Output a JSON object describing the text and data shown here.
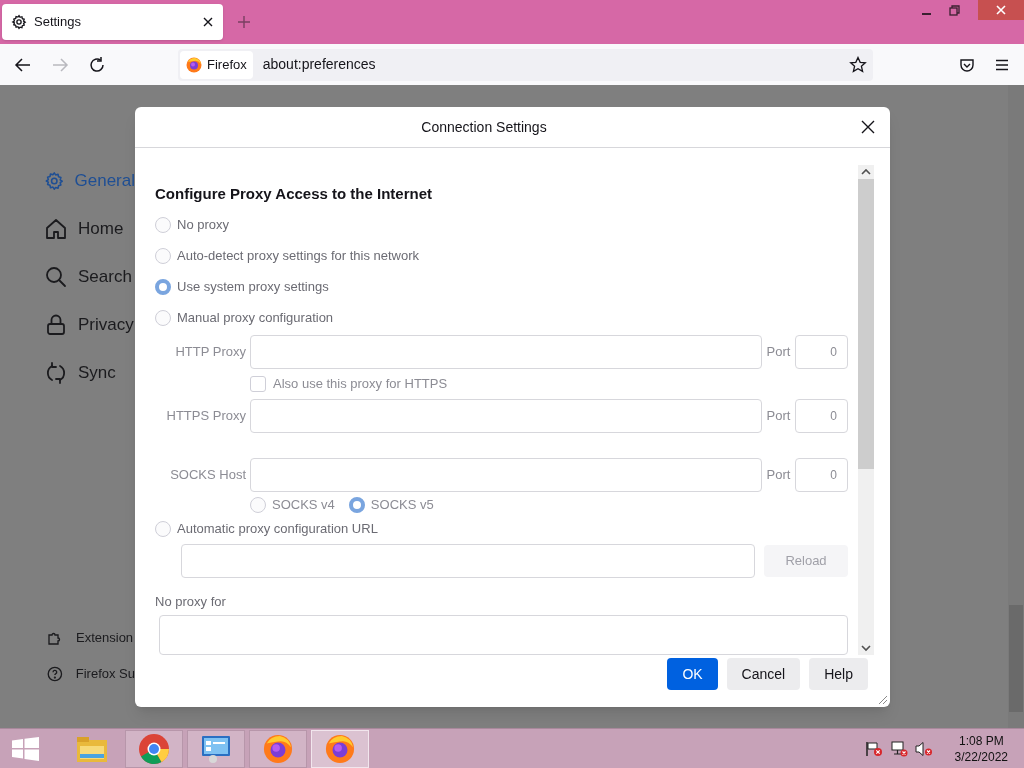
{
  "browser": {
    "tab": {
      "title": "Settings",
      "selected": true
    },
    "identity": "Firefox",
    "url": "about:preferences",
    "forward_disabled": true
  },
  "sidebar": {
    "items": [
      {
        "label": "General",
        "kind": "gear",
        "selected": true
      },
      {
        "label": "Home",
        "kind": "home",
        "selected": false
      },
      {
        "label": "Search",
        "kind": "search",
        "selected": false
      },
      {
        "label": "Privacy",
        "kind": "lock",
        "selected": false
      },
      {
        "label": "Sync",
        "kind": "sync",
        "selected": false
      }
    ],
    "footer": [
      {
        "label": "Extension",
        "kind": "puzzle"
      },
      {
        "label": "Firefox Su",
        "kind": "help"
      }
    ]
  },
  "dialog": {
    "title": "Connection Settings",
    "heading": "Configure Proxy Access to the Internet",
    "modes": [
      {
        "label": "No proxy",
        "selected": false
      },
      {
        "label": "Auto-detect proxy settings for this network",
        "selected": false
      },
      {
        "label": "Use system proxy settings",
        "selected": true
      },
      {
        "label": "Manual proxy configuration",
        "selected": false
      }
    ],
    "manual": {
      "disabled": true,
      "proxies": [
        {
          "kind": "http",
          "label": "HTTP Proxy",
          "port_label": "Port",
          "port": "0"
        },
        {
          "kind": "https",
          "label": "HTTPS Proxy",
          "port_label": "Port",
          "port": "0"
        },
        {
          "kind": "socks",
          "label": "SOCKS Host",
          "port_label": "Port",
          "port": "0"
        }
      ],
      "also_https": {
        "label": "Also use this proxy for HTTPS",
        "checked": false
      },
      "socks_versions": [
        {
          "label": "SOCKS v4",
          "selected": false
        },
        {
          "label": "SOCKS v5",
          "selected": true
        }
      ]
    },
    "auto_url": {
      "label": "Automatic proxy configuration URL",
      "selected": false,
      "reload": "Reload"
    },
    "no_proxy_label": "No proxy for",
    "buttons": [
      {
        "label": "OK",
        "kind": "primary"
      },
      {
        "label": "Cancel",
        "kind": "secondary"
      },
      {
        "label": "Help",
        "kind": "secondary"
      }
    ]
  },
  "taskbar": {
    "apps": [
      {
        "kind": "explorer",
        "running": false,
        "selected": false
      },
      {
        "kind": "chrome",
        "running": true,
        "selected": false
      },
      {
        "kind": "control-panel",
        "running": true,
        "selected": false
      },
      {
        "kind": "firefox",
        "running": true,
        "selected": false
      },
      {
        "kind": "firefox",
        "running": true,
        "selected": true
      }
    ],
    "time": "1:08 PM",
    "date": "3/22/2022"
  }
}
